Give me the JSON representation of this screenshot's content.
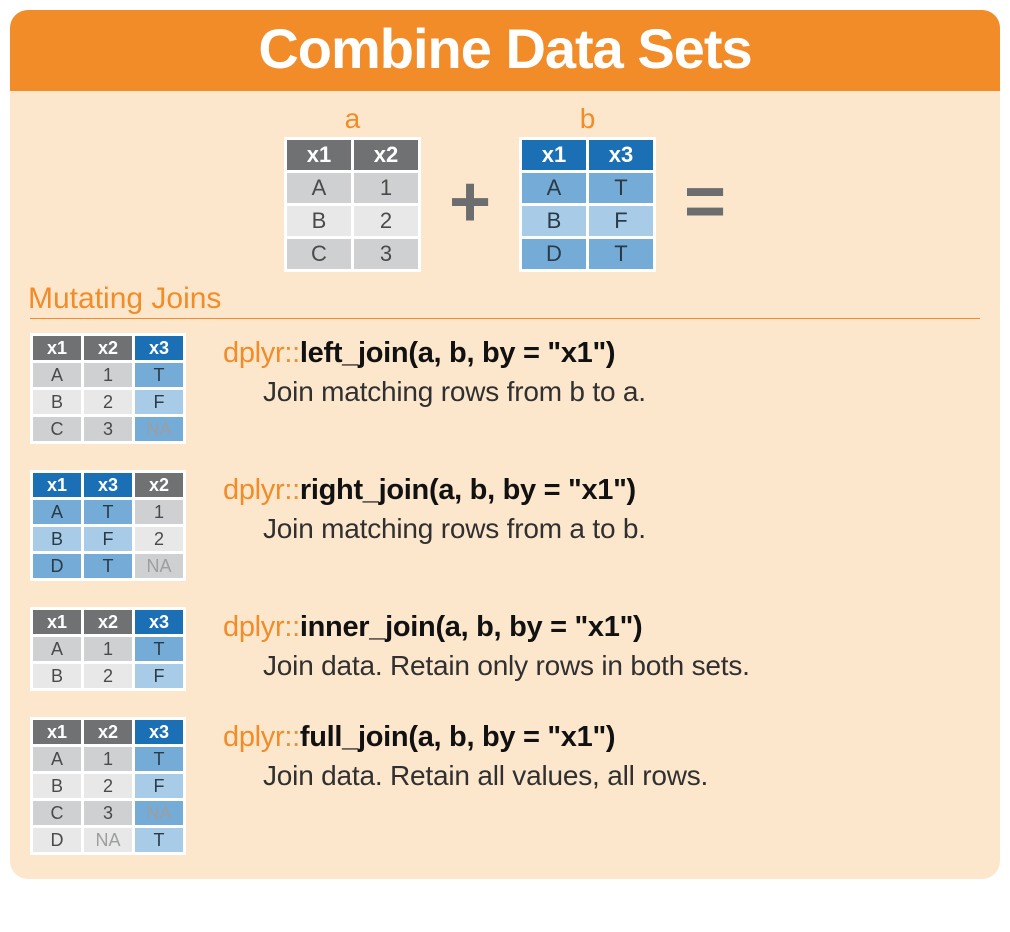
{
  "title": "Combine Data Sets",
  "intro": {
    "a_label": "a",
    "b_label": "b",
    "plus": "+",
    "equals": "=",
    "table_a": {
      "headers": [
        "x1",
        "x2"
      ],
      "rows": [
        [
          "A",
          "1"
        ],
        [
          "B",
          "2"
        ],
        [
          "C",
          "3"
        ]
      ]
    },
    "table_b": {
      "headers": [
        "x1",
        "x3"
      ],
      "rows": [
        [
          "A",
          "T"
        ],
        [
          "B",
          "F"
        ],
        [
          "D",
          "T"
        ]
      ]
    }
  },
  "section_heading": "Mutating Joins",
  "joins": [
    {
      "id": "left-join",
      "ns": "dplyr::",
      "call": "left_join(a, b, by = \"x1\")",
      "desc": "Join matching rows from b to a.",
      "table": {
        "cols": [
          {
            "h": "x1",
            "style": "gray"
          },
          {
            "h": "x2",
            "style": "gray"
          },
          {
            "h": "x3",
            "style": "blue"
          }
        ],
        "rows": [
          [
            {
              "v": "A"
            },
            {
              "v": "1"
            },
            {
              "v": "T"
            }
          ],
          [
            {
              "v": "B"
            },
            {
              "v": "2"
            },
            {
              "v": "F"
            }
          ],
          [
            {
              "v": "C"
            },
            {
              "v": "3"
            },
            {
              "v": "NA",
              "na": true
            }
          ]
        ]
      }
    },
    {
      "id": "right-join",
      "ns": "dplyr::",
      "call": "right_join(a, b, by = \"x1\")",
      "desc": "Join matching rows from a to b.",
      "table": {
        "cols": [
          {
            "h": "x1",
            "style": "blue"
          },
          {
            "h": "x3",
            "style": "blue"
          },
          {
            "h": "x2",
            "style": "gray"
          }
        ],
        "rows": [
          [
            {
              "v": "A"
            },
            {
              "v": "T"
            },
            {
              "v": "1"
            }
          ],
          [
            {
              "v": "B"
            },
            {
              "v": "F"
            },
            {
              "v": "2"
            }
          ],
          [
            {
              "v": "D"
            },
            {
              "v": "T"
            },
            {
              "v": "NA",
              "na": true
            }
          ]
        ]
      }
    },
    {
      "id": "inner-join",
      "ns": "dplyr::",
      "call": "inner_join(a, b, by = \"x1\")",
      "desc": "Join data. Retain only rows in both sets.",
      "table": {
        "cols": [
          {
            "h": "x1",
            "style": "gray"
          },
          {
            "h": "x2",
            "style": "gray"
          },
          {
            "h": "x3",
            "style": "blue"
          }
        ],
        "rows": [
          [
            {
              "v": "A"
            },
            {
              "v": "1"
            },
            {
              "v": "T"
            }
          ],
          [
            {
              "v": "B"
            },
            {
              "v": "2"
            },
            {
              "v": "F"
            }
          ]
        ]
      }
    },
    {
      "id": "full-join",
      "ns": "dplyr::",
      "call": "full_join(a, b, by = \"x1\")",
      "desc": "Join data. Retain all values, all rows.",
      "table": {
        "cols": [
          {
            "h": "x1",
            "style": "gray"
          },
          {
            "h": "x2",
            "style": "gray"
          },
          {
            "h": "x3",
            "style": "blue"
          }
        ],
        "rows": [
          [
            {
              "v": "A"
            },
            {
              "v": "1"
            },
            {
              "v": "T"
            }
          ],
          [
            {
              "v": "B"
            },
            {
              "v": "2"
            },
            {
              "v": "F"
            }
          ],
          [
            {
              "v": "C"
            },
            {
              "v": "3"
            },
            {
              "v": "NA",
              "na": true
            }
          ],
          [
            {
              "v": "D"
            },
            {
              "v": "NA",
              "na": true
            },
            {
              "v": "T"
            }
          ]
        ]
      }
    }
  ]
}
